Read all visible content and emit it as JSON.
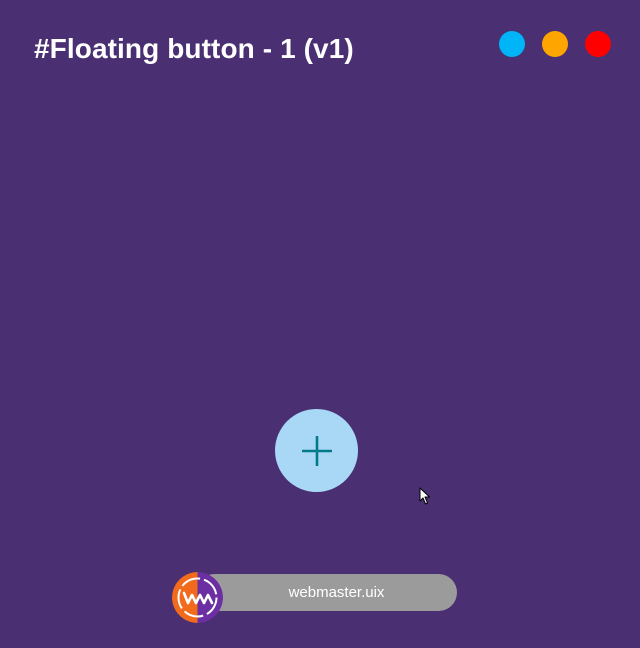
{
  "header": {
    "title": "#Floating button - 1 (v1)"
  },
  "color_dots": [
    {
      "name": "blue",
      "color": "#00b4f8"
    },
    {
      "name": "orange",
      "color": "#ffa500"
    },
    {
      "name": "red",
      "color": "#ff0000"
    }
  ],
  "fab": {
    "icon": "plus-icon",
    "background": "#a8d8f5",
    "icon_color": "#007a8a"
  },
  "badge": {
    "text": "webmaster.uix",
    "logo_colors": [
      "#f26b1d",
      "#6b2fa3"
    ]
  },
  "colors": {
    "background": "#4a3072",
    "title": "#ffffff"
  }
}
